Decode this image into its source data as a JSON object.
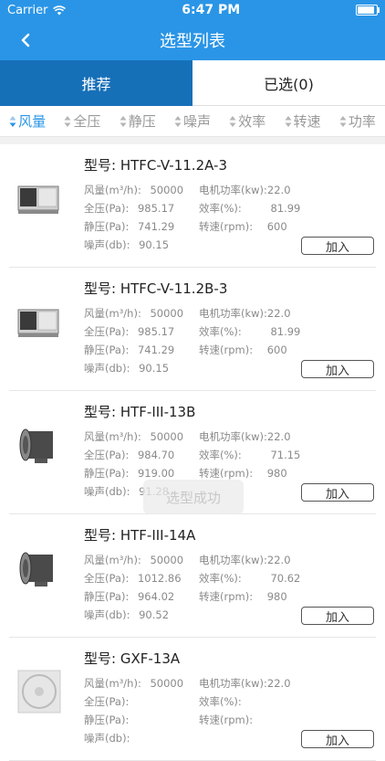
{
  "status_bar": {
    "carrier": "Carrier",
    "time": "6:47 PM"
  },
  "nav": {
    "title": "选型列表"
  },
  "tabs": [
    {
      "label": "推荐",
      "active": true
    },
    {
      "label": "已选(0)",
      "active": false
    }
  ],
  "sort_options": [
    "风量",
    "全压",
    "静压",
    "噪声",
    "效率",
    "转速",
    "功率"
  ],
  "spec_labels": {
    "airflow": "风量(m³/h):",
    "total_pressure": "全压(Pa):",
    "static_pressure": "静压(Pa):",
    "noise": "噪声(db):",
    "motor_power": "电机功率(kw):",
    "efficiency": "效率(%):",
    "speed": "转速(rpm):"
  },
  "model_prefix": "型号:",
  "add_label": "加入",
  "items": [
    {
      "model": "HTFC-V-11.2A-3",
      "image": "cabinet-fan",
      "airflow": "50000",
      "total_pressure": "985.17",
      "static_pressure": "741.29",
      "noise": "90.15",
      "motor_power": "22.0",
      "efficiency": "81.99",
      "speed": "600"
    },
    {
      "model": "HTFC-V-11.2B-3",
      "image": "cabinet-fan",
      "airflow": "50000",
      "total_pressure": "985.17",
      "static_pressure": "741.29",
      "noise": "90.15",
      "motor_power": "22.0",
      "efficiency": "81.99",
      "speed": "600"
    },
    {
      "model": "HTF-III-13B",
      "image": "axial-fan",
      "airflow": "50000",
      "total_pressure": "984.70",
      "static_pressure": "919.00",
      "noise": "91.28",
      "motor_power": "22.0",
      "efficiency": "71.15",
      "speed": "980"
    },
    {
      "model": "HTF-III-14A",
      "image": "axial-fan",
      "airflow": "50000",
      "total_pressure": "1012.86",
      "static_pressure": "964.02",
      "noise": "90.52",
      "motor_power": "22.0",
      "efficiency": "70.62",
      "speed": "980"
    },
    {
      "model": "GXF-13A",
      "image": "round-fan",
      "airflow": "50000",
      "total_pressure": "",
      "static_pressure": "",
      "noise": "",
      "motor_power": "22.0",
      "efficiency": "",
      "speed": ""
    }
  ],
  "toast": "选型成功",
  "colors": {
    "primary": "#2a95e6",
    "tab_active": "#1670b8"
  }
}
